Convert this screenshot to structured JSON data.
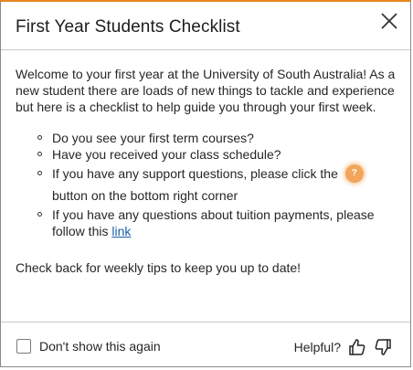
{
  "dialog": {
    "title": "First Year Students Checklist",
    "close_icon": "close-icon",
    "accent_color": "#e6861e"
  },
  "body": {
    "intro": "Welcome to your first year at the University of South Australia! As a new student there are loads of new things to tackle and experience but here is a checklist to help guide you through your first week.",
    "items": [
      "Do you see your first term courses?",
      "Have you received your class schedule?",
      "on the bottom right corner"
    ],
    "support_prefix": "If you have any support questions, please click the",
    "support_suffix": "button",
    "tuition_prefix": "If you have any questions about tuition payments, please follow this",
    "tuition_link": "link",
    "closing": "Check back for weekly tips to keep you up to date!",
    "help_icon": "help-icon",
    "help_icon_color": "#f3a55b",
    "link_color": "#1a5fa8"
  },
  "footer": {
    "dont_show_label": "Don't show this again",
    "dont_show_checked": false,
    "helpful_label": "Helpful?",
    "thumbs_up_icon": "thumbs-up-icon",
    "thumbs_down_icon": "thumbs-down-icon"
  }
}
